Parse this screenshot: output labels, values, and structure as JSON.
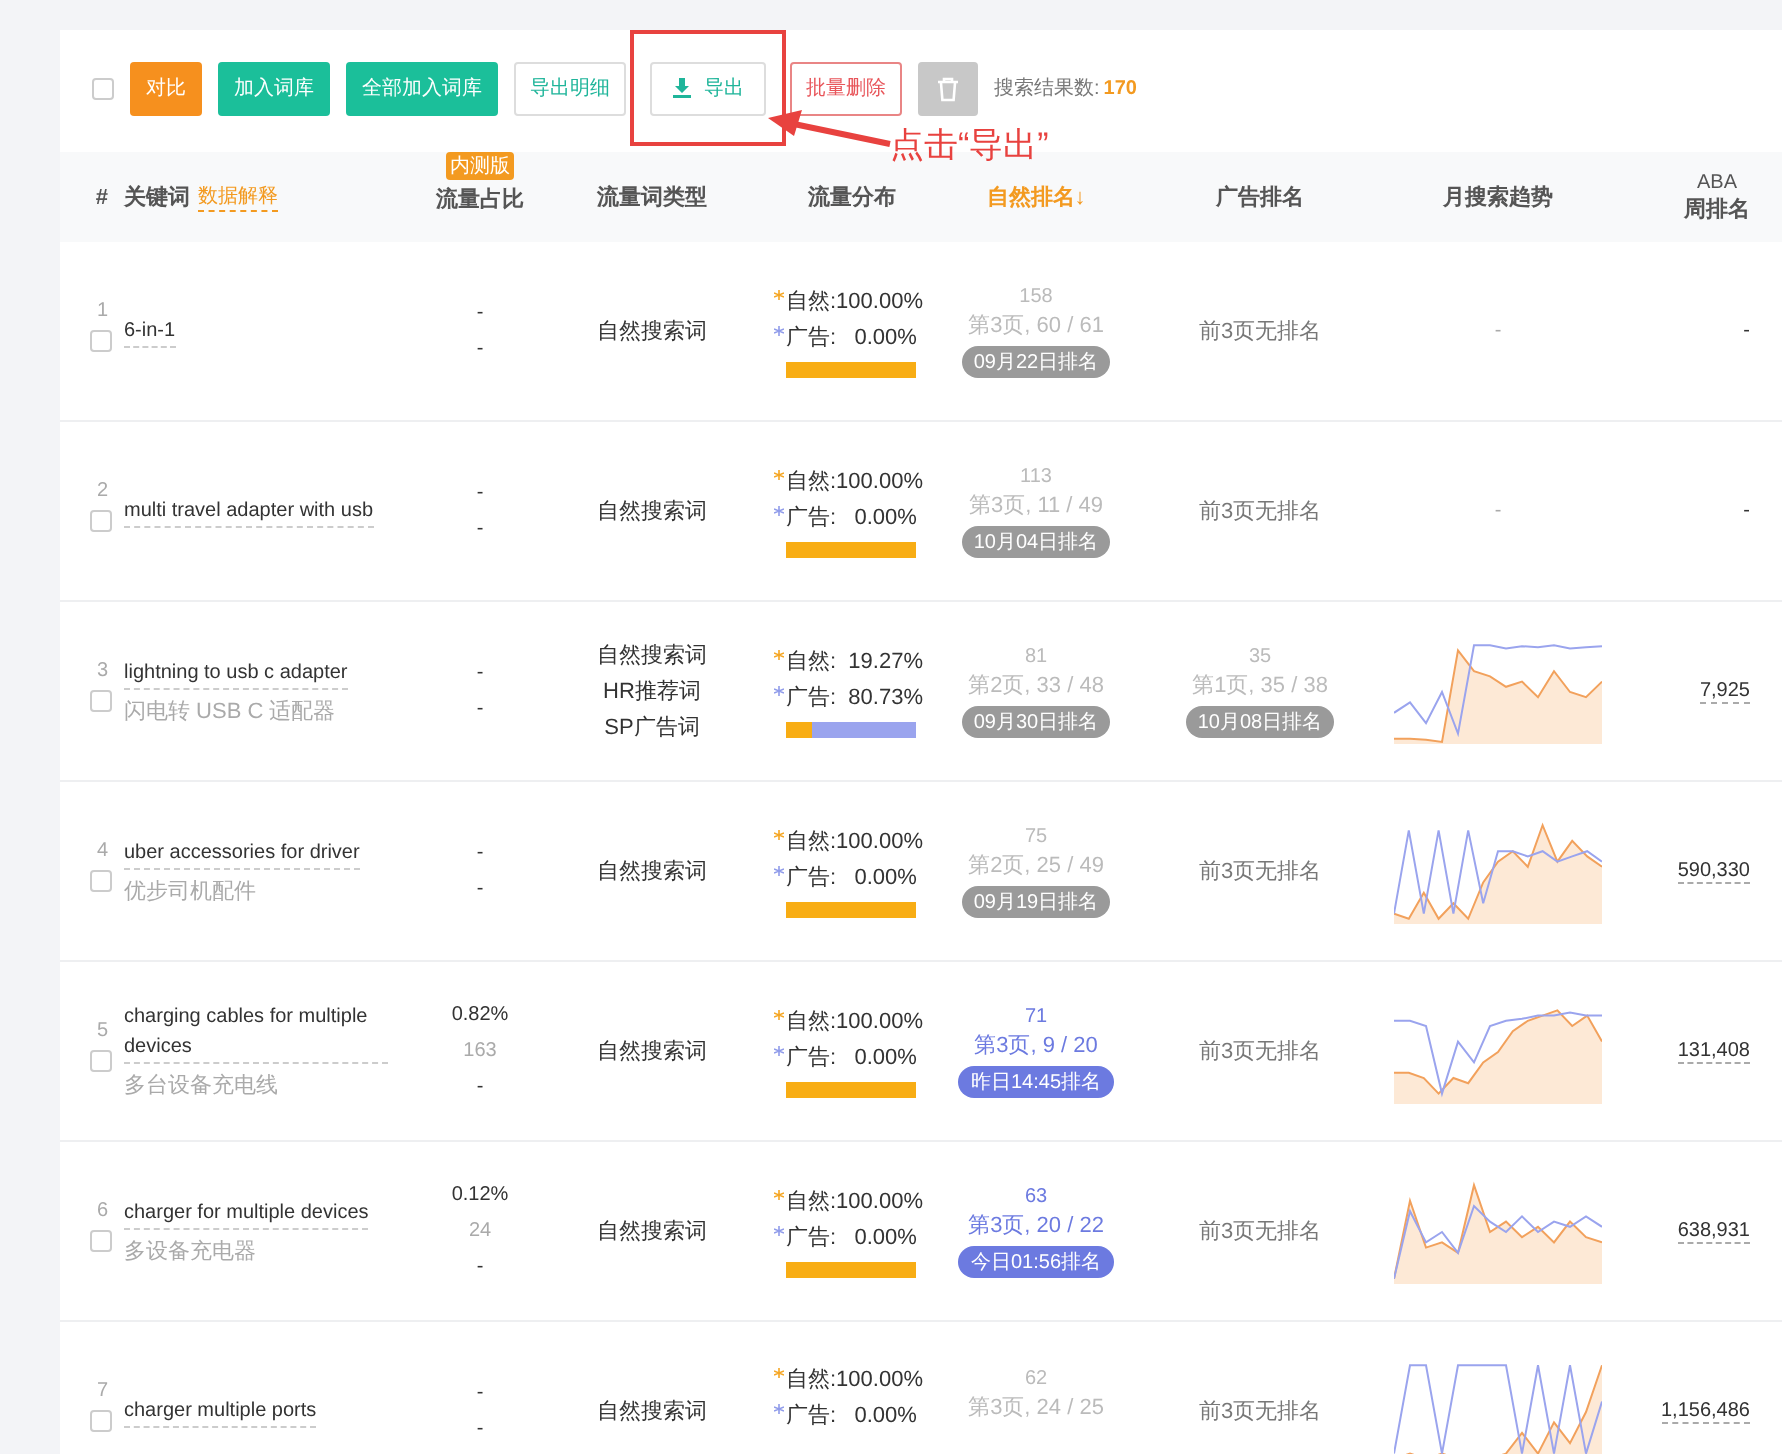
{
  "toolbar": {
    "checked": false,
    "buttons": [
      {
        "kind": "orange",
        "label": "对比"
      },
      {
        "kind": "green",
        "label": "加入词库"
      },
      {
        "kind": "green",
        "label": "全部加入词库"
      },
      {
        "kind": "outline-green",
        "label": "导出明细"
      },
      {
        "kind": "export",
        "label": "导出"
      },
      {
        "kind": "outline-red",
        "label": "批量删除"
      },
      {
        "kind": "trash"
      }
    ],
    "result_label": "搜索结果数:",
    "result_count": "170"
  },
  "annotation": {
    "text": "点击“导出”"
  },
  "columns": [
    {
      "label": "#",
      "sorted": false
    },
    {
      "label": "关键词",
      "link": "数据解释",
      "sorted": false
    },
    {
      "label": "流量占比",
      "badge": "内测版",
      "sorted": false
    },
    {
      "label": "流量词类型",
      "sorted": false
    },
    {
      "label": "流量分布",
      "sorted": false
    },
    {
      "label": "自然排名↓",
      "sorted": true
    },
    {
      "label": "广告排名",
      "sorted": false
    },
    {
      "label": "月搜索趋势",
      "sorted": false
    },
    {
      "label": "ABA",
      "label2": "周排名",
      "sorted": false
    }
  ],
  "rows": [
    {
      "index": "1",
      "checked": false,
      "keyword": "6-in-1",
      "share": [
        "-",
        "-"
      ],
      "types": [
        "自然搜索词"
      ],
      "natural": "自然:100.00%",
      "ad": "广告:   0.00%",
      "level": 1,
      "rank": {
        "rank": "158",
        "page": "第3页, 60 / 61",
        "badge": "09月22日排名",
        "recent": false
      },
      "ad_rank": {
        "kind": "none",
        "text": "前3页无排名"
      },
      "trend": {
        "kind": "text",
        "text": "-"
      },
      "aba": "-"
    },
    {
      "index": "2",
      "checked": false,
      "keyword": "multi travel adapter with usb",
      "share": [
        "-",
        "-"
      ],
      "types": [
        "自然搜索词"
      ],
      "natural": "自然:100.00%",
      "ad": "广告:   0.00%",
      "level": 1,
      "rank": {
        "rank": "113",
        "page": "第3页, 11 / 49",
        "badge": "10月04日排名",
        "recent": false
      },
      "ad_rank": {
        "kind": "none",
        "text": "前3页无排名"
      },
      "trend": {
        "kind": "text",
        "text": "-"
      },
      "aba": "-"
    },
    {
      "index": "3",
      "checked": false,
      "keyword": "lightning to usb c adapter",
      "translation": "闪电转 USB C 适配器",
      "share": [
        "-",
        "-"
      ],
      "types": [
        "自然搜索词",
        "HR推荐词",
        "SP广告词"
      ],
      "natural": "自然:  19.27%",
      "ad": "广告:  80.73%",
      "level": 0.1927,
      "rank": {
        "rank": "81",
        "page": "第2页, 33 / 48",
        "badge": "09月30日排名",
        "recent": false
      },
      "ad_rank": {
        "kind": "ranked",
        "rank": "35",
        "page": "第1页, 35 / 38",
        "badge": "10月08日排名"
      },
      "trend": {
        "kind": "sparkline"
      },
      "aba": "7,925"
    },
    {
      "index": "4",
      "checked": false,
      "keyword": "uber accessories for driver",
      "translation": "优步司机配件",
      "share": [
        "-",
        "-"
      ],
      "types": [
        "自然搜索词"
      ],
      "natural": "自然:100.00%",
      "ad": "广告:   0.00%",
      "level": 1,
      "rank": {
        "rank": "75",
        "page": "第2页, 25 / 49",
        "badge": "09月19日排名",
        "recent": false
      },
      "ad_rank": {
        "kind": "none",
        "text": "前3页无排名"
      },
      "trend": {
        "kind": "sparkline"
      },
      "aba": "590,330"
    },
    {
      "index": "5",
      "checked": false,
      "keyword": "charging cables for multiple devices",
      "translation": "多台设备充电线",
      "share": [
        "0.82%",
        "163",
        "-"
      ],
      "types": [
        "自然搜索词"
      ],
      "natural": "自然:100.00%",
      "ad": "广告:   0.00%",
      "level": 1,
      "rank": {
        "rank": "71",
        "page": "第3页, 9 / 20",
        "badge": "昨日14:45排名",
        "recent": true
      },
      "ad_rank": {
        "kind": "none",
        "text": "前3页无排名"
      },
      "trend": {
        "kind": "sparkline"
      },
      "aba": "131,408"
    },
    {
      "index": "6",
      "checked": false,
      "keyword": "charger for multiple devices",
      "translation": "多设备充电器",
      "share": [
        "0.12%",
        "24",
        "-"
      ],
      "types": [
        "自然搜索词"
      ],
      "natural": "自然:100.00%",
      "ad": "广告:   0.00%",
      "level": 1,
      "rank": {
        "rank": "63",
        "page": "第3页, 20 / 22",
        "badge": "今日01:56排名",
        "recent": true
      },
      "ad_rank": {
        "kind": "none",
        "text": "前3页无排名"
      },
      "trend": {
        "kind": "sparkline"
      },
      "aba": "638,931"
    },
    {
      "index": "7",
      "checked": false,
      "keyword": "charger multiple ports",
      "share": [
        "-",
        "-"
      ],
      "types": [
        "自然搜索词"
      ],
      "natural": "自然:100.00%",
      "ad": "广告:   0.00%",
      "rank": {
        "rank": "62",
        "page": "第3页, 24 / 25"
      },
      "ad_rank": {
        "kind": "none",
        "text": "前3页无排名"
      },
      "trend": {
        "kind": "sparkline"
      },
      "aba": "1,156,486"
    }
  ]
}
